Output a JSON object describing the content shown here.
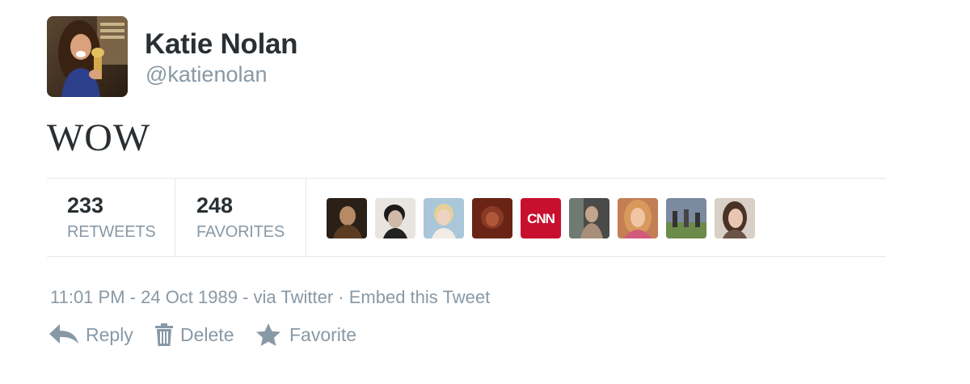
{
  "author": {
    "display_name": "Katie Nolan",
    "screen_name": "@katienolan"
  },
  "tweet": {
    "text": "WOW"
  },
  "stats": {
    "retweets": {
      "count": "233",
      "label": "RETWEETS"
    },
    "favorites": {
      "count": "248",
      "label": "FAVORITES"
    }
  },
  "favoriters": [
    {
      "color": "#2a2018"
    },
    {
      "color": "#e8e4e0"
    },
    {
      "color": "#a9c7d9"
    },
    {
      "color": "#6a2416"
    },
    {
      "color": "#c8102e",
      "text": "CNN"
    },
    {
      "color": "#4a4a48"
    },
    {
      "color": "#c47e54"
    },
    {
      "color": "#7c8aa0"
    },
    {
      "color": "#d8cfc6"
    }
  ],
  "meta": {
    "time": "11:01 PM",
    "sep1": " - ",
    "date": "24 Oct 1989",
    "sep2": " - ",
    "source": "via Twitter",
    "sep3": " · ",
    "embed": "Embed this Tweet"
  },
  "actions": {
    "reply": "Reply",
    "delete": "Delete",
    "favorite": "Favorite"
  },
  "colors": {
    "text": "#292f33",
    "muted": "#8899a6",
    "border": "#e1e8ed"
  }
}
